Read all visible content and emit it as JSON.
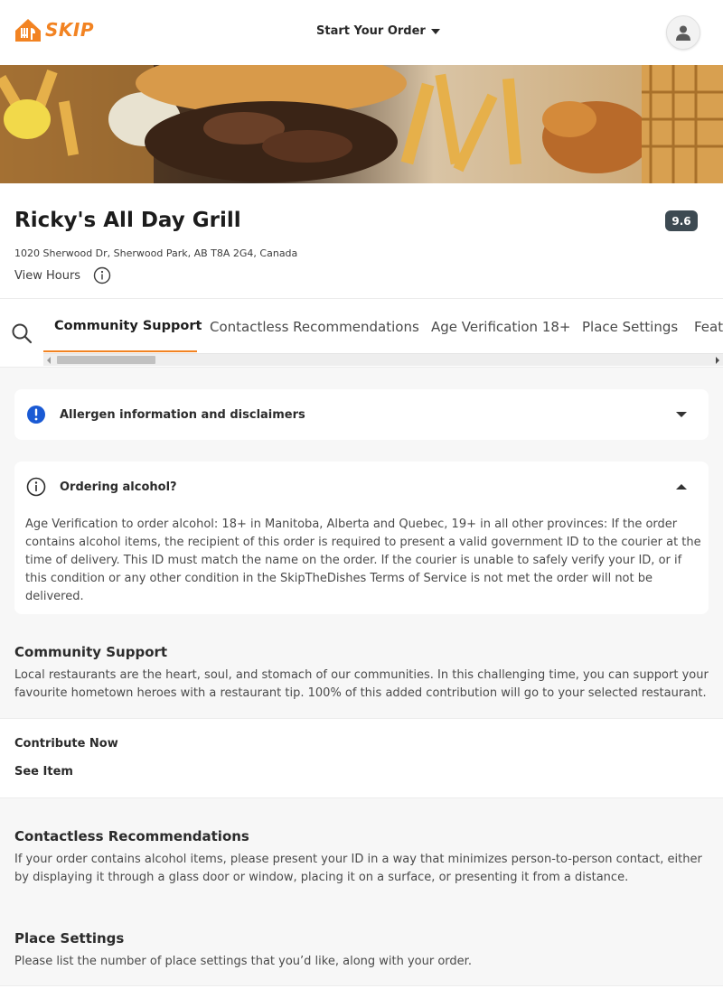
{
  "brand": {
    "logo_text": "SKIP",
    "accent_color": "#f28322"
  },
  "header": {
    "order_button": "Start Your Order",
    "order_caret_icon": "caret-down-icon",
    "profile_icon": "user-icon"
  },
  "restaurant": {
    "name": "Ricky's All Day Grill",
    "rating": "9.6",
    "address": "1020 Sherwood Dr, Sherwood Park, AB T8A 2G4, Canada",
    "hours_link": "View Hours"
  },
  "nav": {
    "tabs": [
      {
        "label": "Community Support",
        "active": true
      },
      {
        "label": "Contactless Recommendations",
        "active": false
      },
      {
        "label": "Age Verification 18+",
        "active": false
      },
      {
        "label": "Place Settings",
        "active": false
      },
      {
        "label": "Featured",
        "active": false
      }
    ]
  },
  "cards": {
    "allergen": {
      "title": "Allergen information and disclaimers",
      "expanded": false
    },
    "alcohol": {
      "title": "Ordering alcohol?",
      "expanded": true,
      "body": "Age Verification to order alcohol: 18+ in Manitoba, Alberta and Quebec, 19+ in all other provinces: If the order contains alcohol items, the recipient of this order is required to present a valid government ID to the courier at the time of delivery. This ID must match the name on the order. If the courier is unable to safely verify your ID, or if this condition or any other condition in the SkipTheDishes Terms of Service is not met the order will not be delivered."
    }
  },
  "sections": {
    "community": {
      "title": "Community Support",
      "description": "Local restaurants are the heart, soul, and stomach of our communities. In this challenging time, you can support your favourite hometown heroes with a restaurant tip. 100% of this added contribution will go to your selected restaurant.",
      "item_name": "Contribute Now",
      "item_action": "See Item"
    },
    "contactless": {
      "title": "Contactless Recommendations",
      "description": "If your order contains alcohol items, please present your ID in a way that minimizes person-to-person contact, either by displaying it through a glass door or window, placing it on a surface, or presenting it from a distance."
    },
    "place_settings": {
      "title": "Place Settings",
      "description": "Please list the number of place settings that you’d like, along with your order."
    }
  }
}
